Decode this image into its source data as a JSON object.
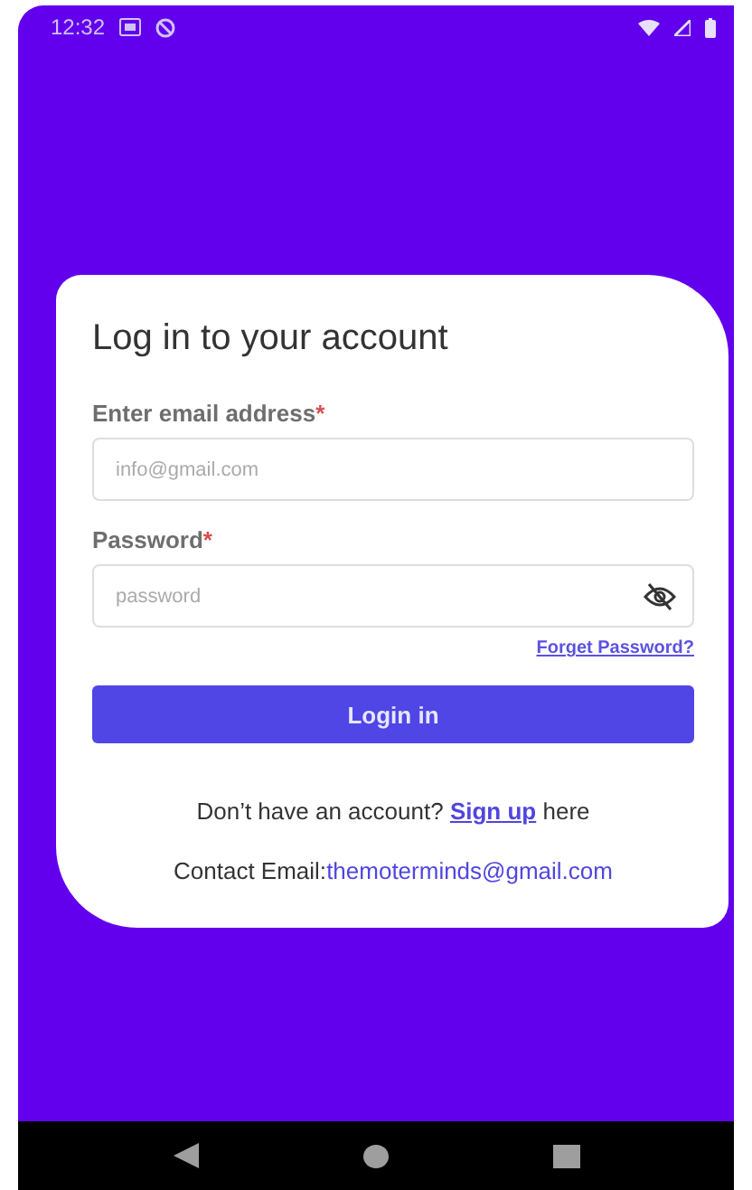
{
  "status_bar": {
    "time": "12:32"
  },
  "card": {
    "title": "Log in to your account",
    "fields": [
      {
        "label": "Enter email address",
        "required_mark": "*",
        "placeholder": "info@gmail.com",
        "kind": "email"
      },
      {
        "label": "Password",
        "required_mark": "*",
        "placeholder": "password",
        "kind": "password"
      }
    ],
    "forgot_link": "Forget Password?",
    "login_button": "Login in",
    "signup_prompt": {
      "before": "Don’t have an account?",
      "link": "Sign up",
      "after": "here"
    },
    "contact": {
      "label": "Contact Email:",
      "email": "themoterminds@gmail.com"
    }
  }
}
